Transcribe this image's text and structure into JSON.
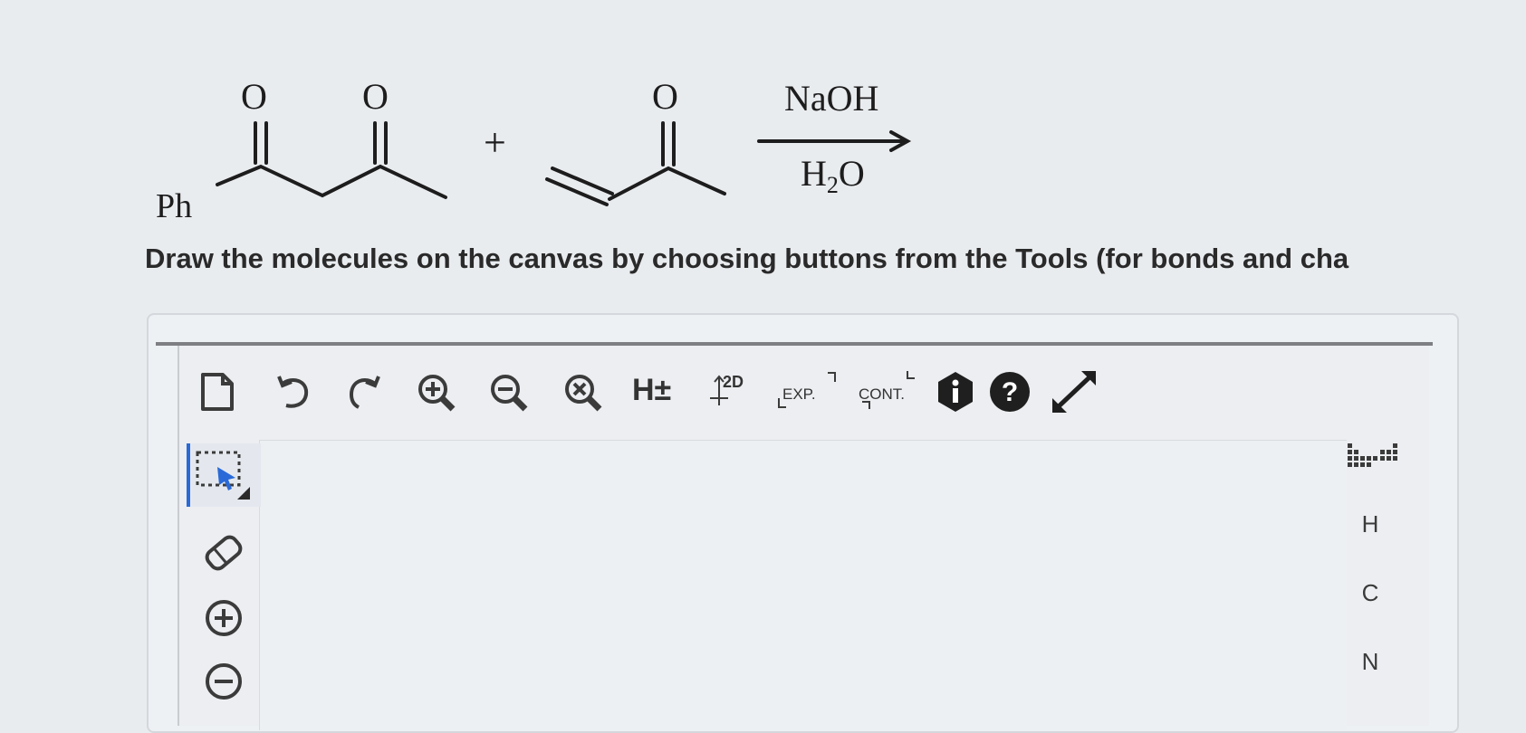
{
  "reaction": {
    "reactant1_label": "Ph",
    "oxygen_label": "O",
    "plus": "+",
    "reagent_top": "NaOH",
    "reagent_bottom_main": "H",
    "reagent_bottom_sub": "2",
    "reagent_bottom_end": "O"
  },
  "instruction": "Draw the molecules on the canvas by choosing buttons from the Tools (for bonds and cha",
  "toolbar": {
    "items": [
      {
        "name": "new-document-icon"
      },
      {
        "name": "undo-icon"
      },
      {
        "name": "redo-icon"
      },
      {
        "name": "zoom-in-icon"
      },
      {
        "name": "zoom-out-icon"
      },
      {
        "name": "zoom-reset-icon"
      },
      {
        "name": "hydrogen-toggle-icon",
        "label": "H±"
      },
      {
        "name": "clean-2d-icon",
        "label": "2D"
      },
      {
        "name": "expand-icon",
        "label": "EXP."
      },
      {
        "name": "contract-icon",
        "label": "CONT."
      },
      {
        "name": "info-icon"
      },
      {
        "name": "help-icon"
      },
      {
        "name": "fullscreen-icon"
      }
    ]
  },
  "left_tools": [
    "select-lasso-icon",
    "eraser-icon",
    "charge-plus-icon",
    "charge-minus-icon"
  ],
  "elements": [
    "H",
    "C",
    "N"
  ],
  "colors": {
    "accent": "#2a6ad8",
    "text": "#2a2a2a",
    "icon": "#3b3b3b",
    "dark_badge": "#1f1f1f"
  }
}
